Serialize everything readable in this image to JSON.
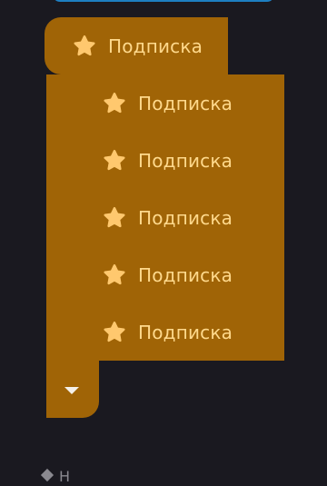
{
  "colors": {
    "background": "#1a1920",
    "menu_fill": "#a06406",
    "label_text": "#ffd98c",
    "star_icon": "#ffc86e",
    "caret": "#f4f0ea",
    "top_pill": "#1d7fc2"
  },
  "menu": {
    "head": {
      "icon": "star-icon",
      "label": "Подписка"
    },
    "items": [
      {
        "icon": "star-icon",
        "label": "Подписка"
      },
      {
        "icon": "star-icon",
        "label": "Подписка"
      },
      {
        "icon": "star-icon",
        "label": "Подписка"
      },
      {
        "icon": "star-icon",
        "label": "Подписка"
      },
      {
        "icon": "star-icon",
        "label": "Подписка"
      }
    ],
    "expand_icon": "chevron-down-icon"
  },
  "bottom_peek": {
    "icon": "diamond-icon",
    "text": "Н"
  }
}
